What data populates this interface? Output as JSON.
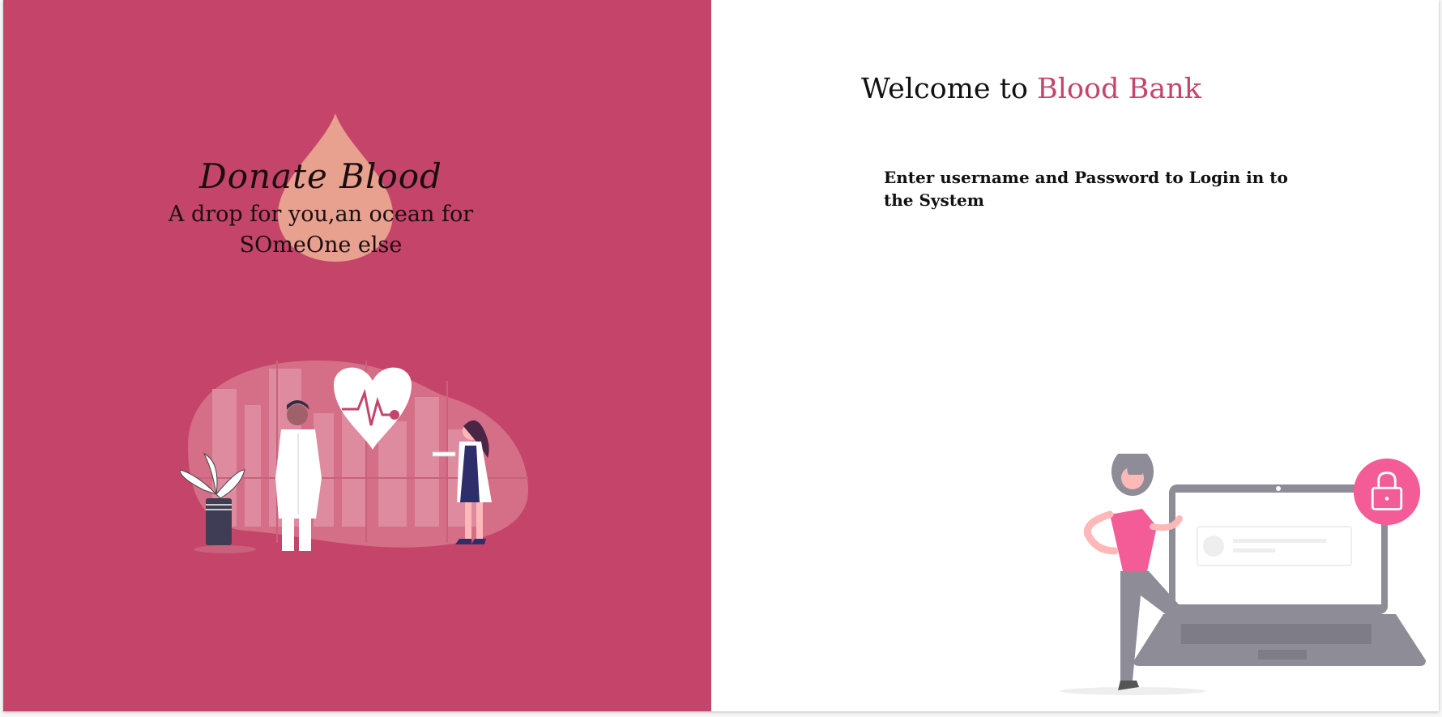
{
  "left": {
    "title": "Donate Blood",
    "tagline": "A drop for you,an ocean for SOmeOne else"
  },
  "right": {
    "welcome_prefix": "Welcome to ",
    "welcome_brand": "Blood Bank",
    "instructions": "Enter username and Password to Login in to the System"
  },
  "icons": {
    "drop": "blood-drop-icon",
    "heart": "heartbeat-heart-icon",
    "lock": "lock-icon"
  },
  "colors": {
    "brand": "#c44569",
    "drop": "#e8a08f",
    "accent_pink": "#f45c97",
    "laptop_gray": "#8e8c96"
  }
}
